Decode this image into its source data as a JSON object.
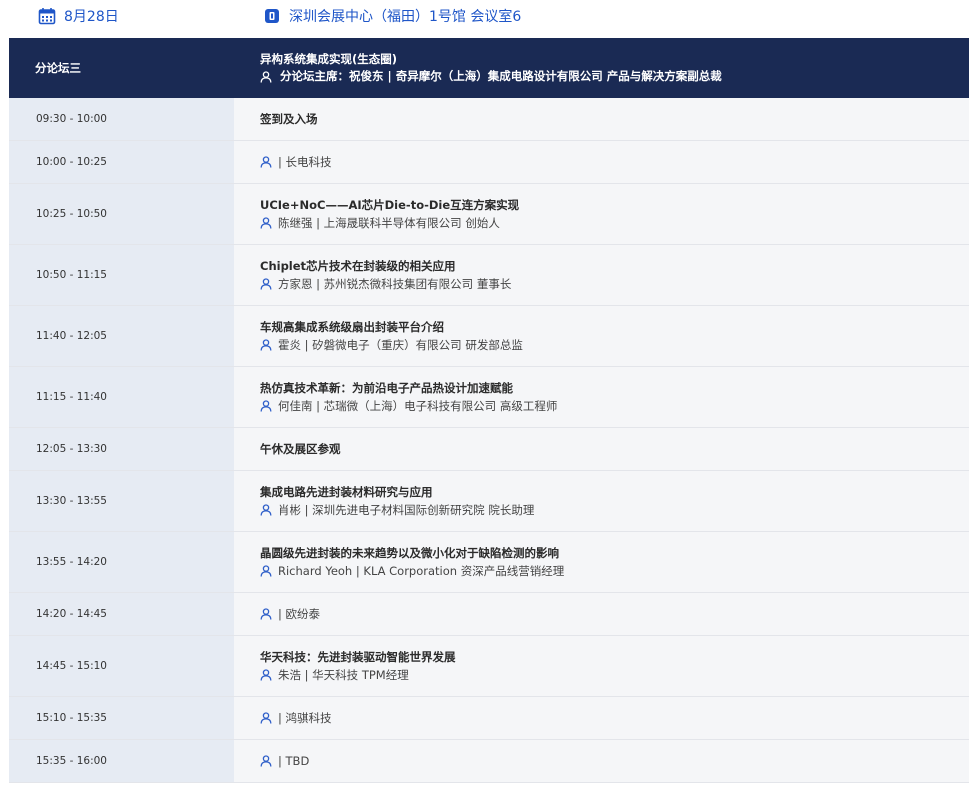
{
  "topbar": {
    "date": "8月28日",
    "venue": "深圳会展中心（福田）1号馆 会议室6",
    "date_icon": "calendar-icon",
    "venue_icon": "building-icon",
    "accent_color": "#1f56c8"
  },
  "forum": {
    "label": "分论坛三",
    "title": "异构系统集成实现(生态圈)",
    "host": "分论坛主席：祝俊东 | 奇异摩尔（上海）集成电路设计有限公司 产品与解决方案副总裁",
    "header_color": "#1a2a54"
  },
  "rows": [
    {
      "time": "09:30 - 10:00",
      "title": "签到及入场",
      "speaker": ""
    },
    {
      "time": "10:00 - 10:25",
      "title": "",
      "speaker": "| 长电科技"
    },
    {
      "time": "10:25 - 10:50",
      "title": "UCIe+NoC——AI芯片Die-to-Die互连方案实现",
      "speaker": "陈继强 | 上海晟联科半导体有限公司 创始人"
    },
    {
      "time": "10:50 - 11:15",
      "title": "Chiplet芯片技术在封装级的相关应用",
      "speaker": "方家恩 | 苏州锐杰微科技集团有限公司 董事长"
    },
    {
      "time": "11:40 - 12:05",
      "title": "车规高集成系统级扇出封装平台介绍",
      "speaker": "霍炎 | 矽磐微电子（重庆）有限公司 研发部总监"
    },
    {
      "time": "11:15 - 11:40",
      "title": "热仿真技术革新：为前沿电子产品热设计加速赋能",
      "speaker": "何佳南 | 芯瑞微（上海）电子科技有限公司 高级工程师"
    },
    {
      "time": "12:05 - 13:30",
      "title": "午休及展区参观",
      "speaker": ""
    },
    {
      "time": "13:30 - 13:55",
      "title": "集成电路先进封装材料研究与应用",
      "speaker": "肖彬 | 深圳先进电子材料国际创新研究院 院长助理"
    },
    {
      "time": "13:55 - 14:20",
      "title": "晶圆级先进封装的未来趋势以及微小化对于缺陷检测的影响",
      "speaker": "Richard Yeoh | KLA Corporation 资深产品线营销经理"
    },
    {
      "time": "14:20 - 14:45",
      "title": "",
      "speaker": "| 欧纷泰"
    },
    {
      "time": "14:45 - 15:10",
      "title": "华天科技：先进封装驱动智能世界发展",
      "speaker": "朱浩 | 华天科技 TPM经理"
    },
    {
      "time": "15:10 - 15:35",
      "title": "",
      "speaker": "| 鸿骐科技"
    },
    {
      "time": "15:35 - 16:00",
      "title": "",
      "speaker": "| TBD"
    }
  ]
}
